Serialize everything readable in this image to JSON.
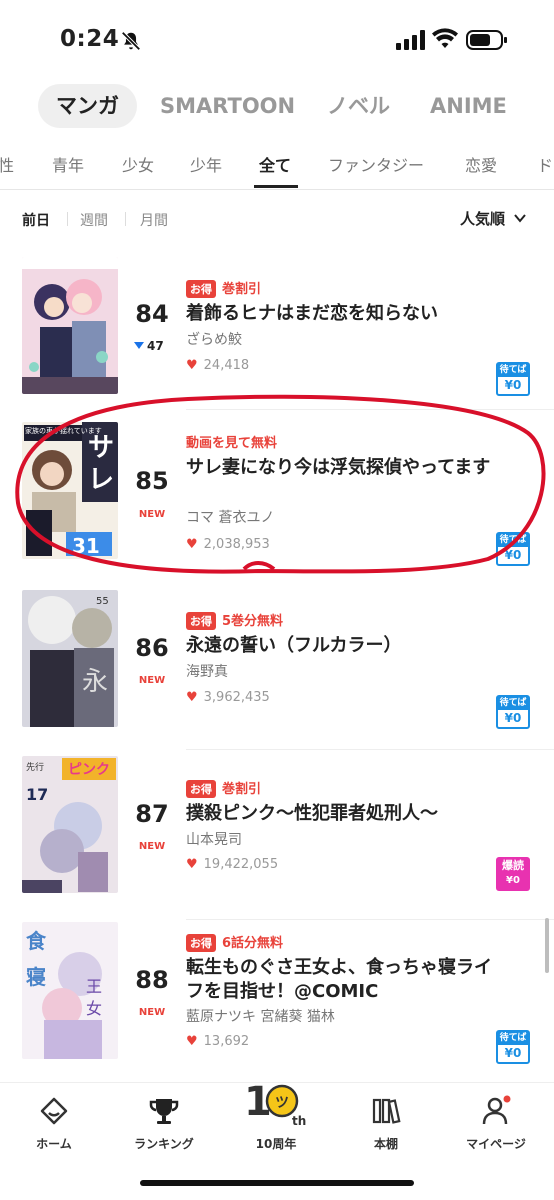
{
  "status": {
    "time": "0:24"
  },
  "category_tabs": [
    "マンガ",
    "SMARTOON",
    "ノベル",
    "ANIME"
  ],
  "genre_tabs": [
    "性",
    "青年",
    "少女",
    "少年",
    "全て",
    "ファンタジー",
    "恋愛",
    "ド"
  ],
  "period_filters": [
    "前日",
    "週間",
    "月間"
  ],
  "sort_label": "人気順",
  "items": [
    {
      "rank": "84",
      "rank_change": "47",
      "promo_badge": "お得",
      "promo_text": "巻割引",
      "title": "着飾るヒナはまだ恋を知らない",
      "author": "ざらめ鮫",
      "likes": "24,418",
      "badge_top": "待てば",
      "badge_bottom": "¥0",
      "badge_color": "#1a8fe3"
    },
    {
      "rank": "85",
      "rank_label": "NEW",
      "promo_text": "動画を見て無料",
      "title": "サレ妻になり今は浮気探偵やってます",
      "author": "コマ 蒼衣ユノ",
      "likes": "2,038,953",
      "badge_top": "待てば",
      "badge_bottom": "¥0",
      "badge_color": "#1a8fe3",
      "cover_text": "家族の車が揺れています"
    },
    {
      "rank": "86",
      "rank_label": "NEW",
      "promo_badge": "お得",
      "promo_text": "5巻分無料",
      "title": "永遠の誓い（フルカラー）",
      "author": "海野真",
      "likes": "3,962,435",
      "badge_top": "待てば",
      "badge_bottom": "¥0",
      "badge_color": "#1a8fe3"
    },
    {
      "rank": "87",
      "rank_label": "NEW",
      "promo_badge": "お得",
      "promo_text": "巻割引",
      "title": "撲殺ピンク〜性犯罪者処刑人〜",
      "author": "山本晃司",
      "likes": "19,422,055",
      "badge_top": "爆読",
      "badge_bottom": "¥0",
      "badge_color": "#e832b0"
    },
    {
      "rank": "88",
      "rank_label": "NEW",
      "promo_badge": "お得",
      "promo_text": "6話分無料",
      "title": "転生ものぐさ王女よ、食っちゃ寝ライフを目指せ！@COMIC",
      "author": "藍原ナツキ 宮緒葵 猫林",
      "likes": "13,692",
      "badge_top": "待てば",
      "badge_bottom": "¥0",
      "badge_color": "#1a8fe3"
    }
  ],
  "bottom_nav": [
    "ホーム",
    "ランキング",
    "10周年",
    "本棚",
    "マイページ"
  ],
  "anniversary_mark": "th",
  "colors": {
    "accent_red": "#e8423a",
    "wait_blue": "#1a8fe3",
    "baku_pink": "#e832b0",
    "annotation_red": "#d8102a"
  }
}
